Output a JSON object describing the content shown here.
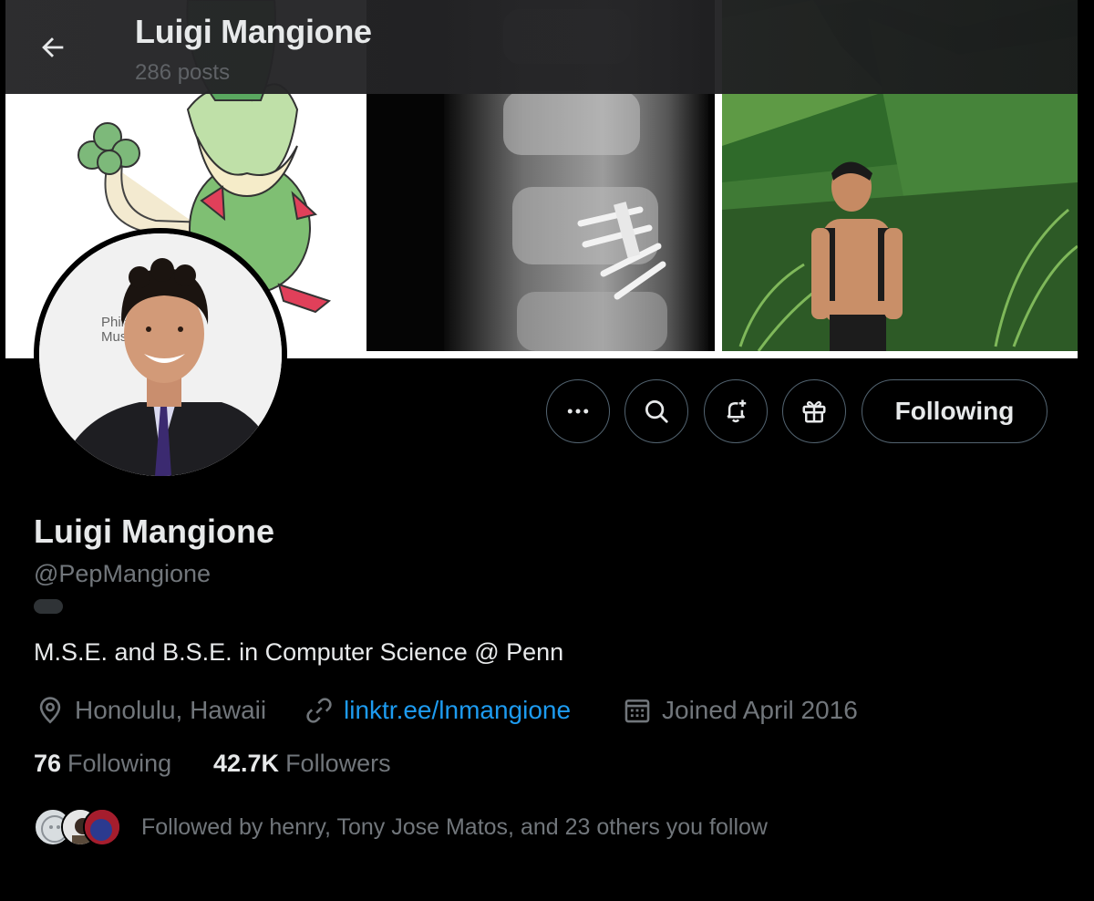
{
  "header": {
    "title": "Luigi Mangione",
    "posts_count": "286 posts",
    "back_icon": "arrow-left-icon"
  },
  "banner": {
    "panels": [
      "pokemon-illustration",
      "spine-xray",
      "hiking-photo"
    ]
  },
  "avatar": {
    "backdrop_text_line1": "Philad",
    "backdrop_text_line2": "Muse"
  },
  "actions": {
    "more_icon": "more-icon",
    "search_icon": "search-icon",
    "notify_icon": "bell-plus-icon",
    "gift_icon": "gift-icon",
    "follow_label": "Following"
  },
  "profile": {
    "name": "Luigi Mangione",
    "handle": "@PepMangione",
    "bio": "M.S.E. and B.S.E. in Computer Science @ Penn",
    "location": "Honolulu, Hawaii",
    "website": "linktr.ee/lnmangione",
    "joined": "Joined April 2016"
  },
  "stats": {
    "following_count": "76",
    "following_label": "Following",
    "followers_count": "42.7K",
    "followers_label": "Followers"
  },
  "followed_by": {
    "text": "Followed by henry, Tony Jose Matos, and 23 others you follow"
  },
  "colors": {
    "background": "#000000",
    "text_primary": "#e7e9ea",
    "text_secondary": "#71767b",
    "link": "#1d9bf0",
    "border": "#536471"
  }
}
